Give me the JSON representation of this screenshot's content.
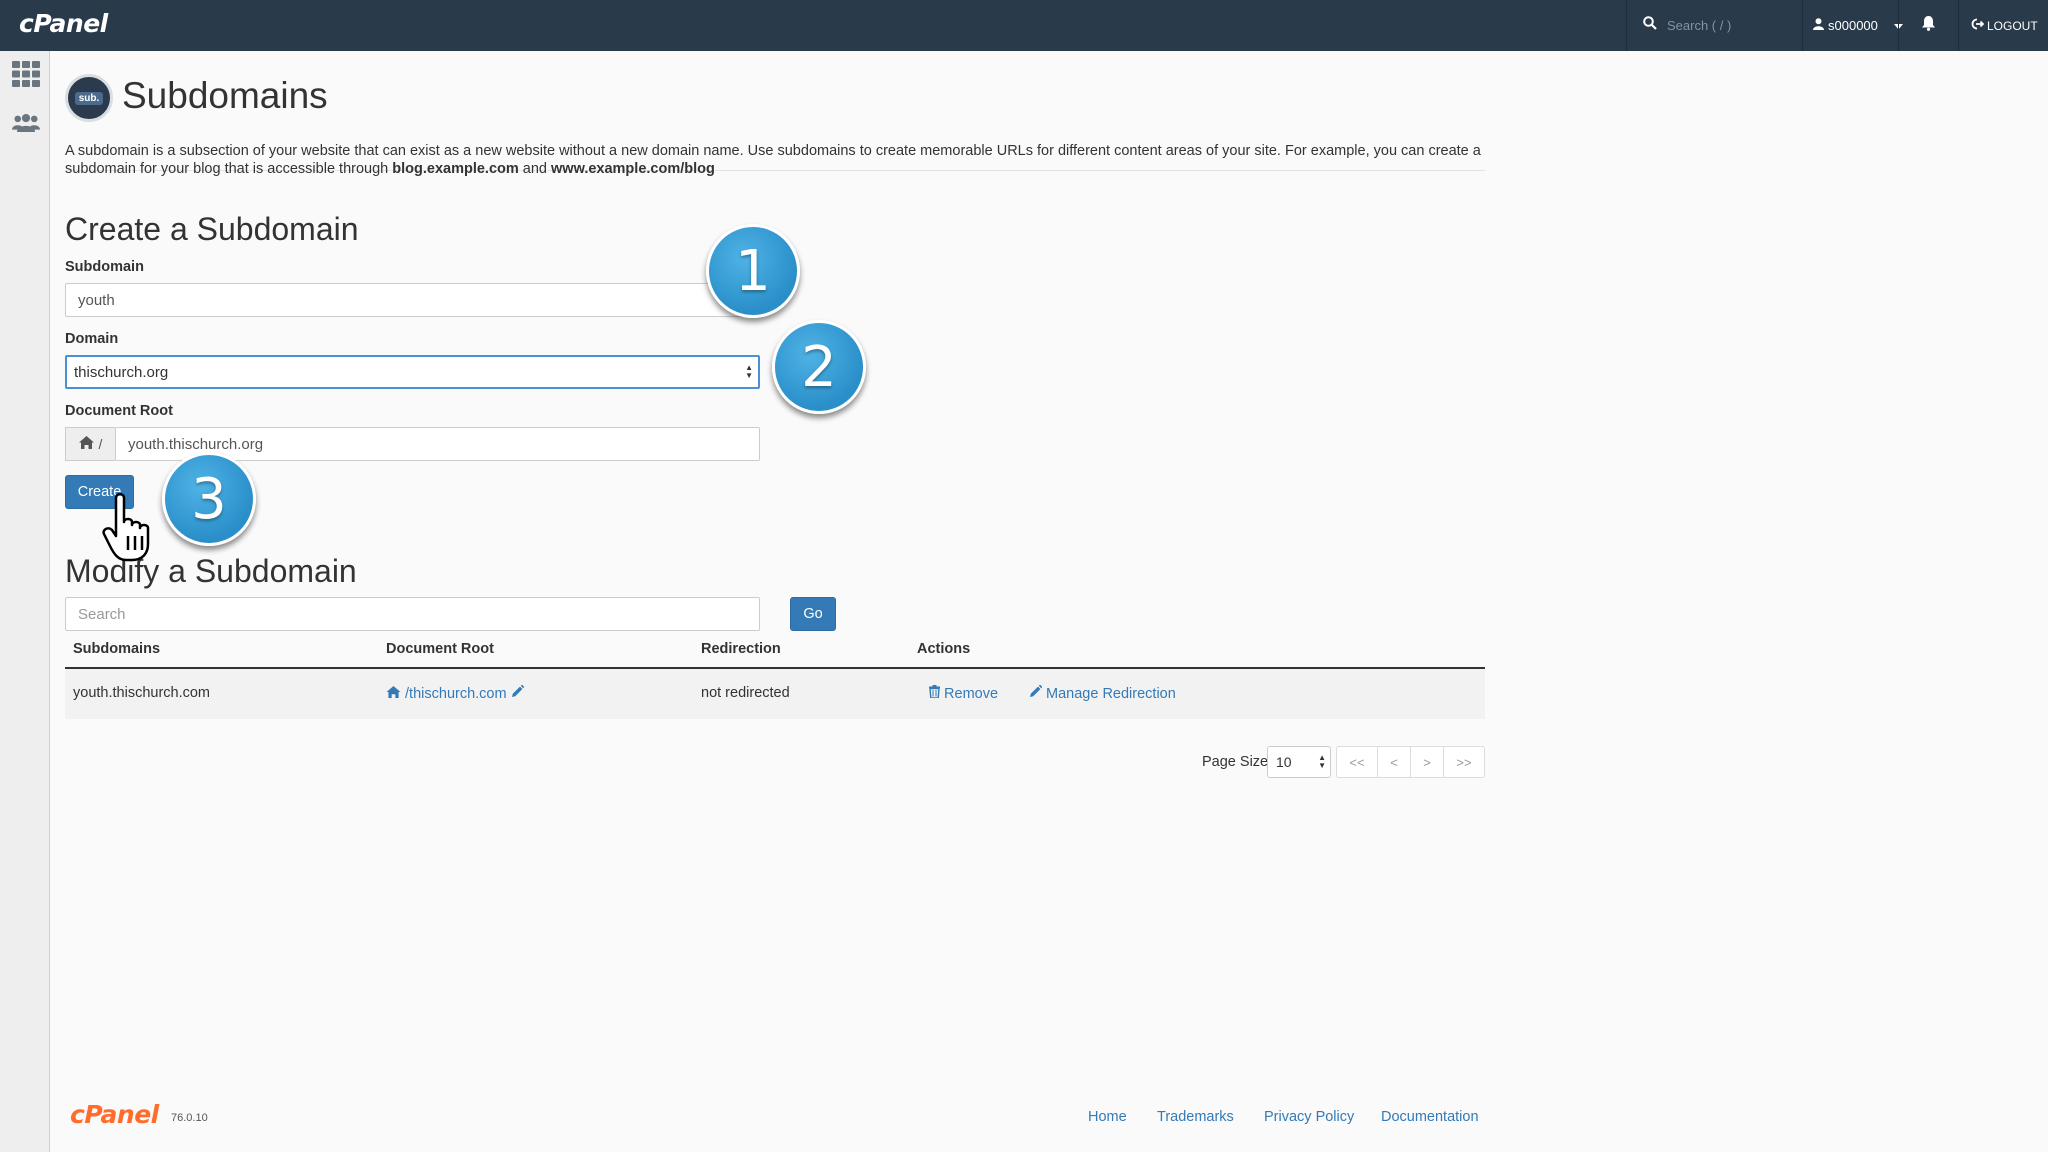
{
  "app": {
    "logo": "cPanel"
  },
  "topbar": {
    "search_placeholder": "Search ( / )",
    "username": "s000000",
    "logout_label": "LOGOUT"
  },
  "sidebar": {
    "items": [
      {
        "icon": "grid-icon"
      },
      {
        "icon": "users-icon"
      }
    ]
  },
  "page": {
    "badge": "sub.",
    "title": "Subdomains",
    "intro_text": "A subdomain is a subsection of your website that can exist as a new website without a new domain name. Use subdomains to create memorable URLs for different content areas of your site. For example, you can create a subdomain for your blog that is accessible through ",
    "intro_example1": "blog.example.com",
    "intro_and": " and ",
    "intro_example2": "www.example.com/blog"
  },
  "create": {
    "heading": "Create a Subdomain",
    "subdomain_label": "Subdomain",
    "subdomain_value": "youth",
    "domain_label": "Domain",
    "domain_value": "thischurch.org",
    "docroot_label": "Document Root",
    "docroot_prefix": "/",
    "docroot_value": "youth.thischurch.org",
    "create_button": "Create"
  },
  "modify": {
    "heading": "Modify a Subdomain",
    "search_placeholder": "Search",
    "go_button": "Go",
    "columns": [
      "Subdomains",
      "Document Root",
      "Redirection",
      "Actions"
    ],
    "rows": [
      {
        "subdomain": "youth.thischurch.com",
        "document_root": "/thischurch.com",
        "redirection": "not redirected",
        "remove_label": "Remove",
        "manage_label": "Manage Redirection"
      }
    ],
    "page_size_label": "Page Size",
    "page_size_value": "10",
    "pager": [
      "<<",
      "<",
      ">",
      ">>"
    ]
  },
  "callouts": [
    "1",
    "2",
    "3"
  ],
  "footer": {
    "logo": "cPanel",
    "version": "76.0.10",
    "links": [
      "Home",
      "Trademarks",
      "Privacy Policy",
      "Documentation"
    ]
  },
  "colors": {
    "topbar": "#293a4a",
    "accent": "#337ab7",
    "callout": "#2a8fc9",
    "footer_logo": "#ff6c2c"
  }
}
